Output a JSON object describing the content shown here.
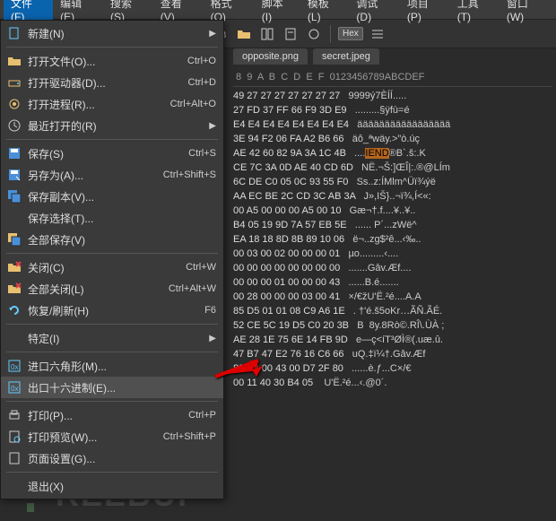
{
  "menubar": [
    "文件(F)",
    "编辑(E)",
    "搜索(S)",
    "查看(V)",
    "格式(O)",
    "脚本(I)",
    "模板(L)",
    "调试(D)",
    "项目(P)",
    "工具(T)",
    "窗口(W)"
  ],
  "toolbar": {
    "hex_label": "Hex"
  },
  "tabs": [
    "opposite.png",
    "secret.jpeg"
  ],
  "menu": {
    "items": [
      {
        "icon": "new",
        "label": "新建(N)",
        "shortcut": "",
        "sub": true
      },
      {
        "sep": true
      },
      {
        "icon": "open",
        "label": "打开文件(O)...",
        "shortcut": "Ctrl+O"
      },
      {
        "icon": "drive",
        "label": "打开驱动器(D)...",
        "shortcut": "Ctrl+D"
      },
      {
        "icon": "proc",
        "label": "打开进程(R)...",
        "shortcut": "Ctrl+Alt+O"
      },
      {
        "icon": "recent",
        "label": "最近打开的(R)",
        "shortcut": "",
        "sub": true
      },
      {
        "sep": true
      },
      {
        "icon": "save",
        "label": "保存(S)",
        "shortcut": "Ctrl+S"
      },
      {
        "icon": "saveas",
        "label": "另存为(A)...",
        "shortcut": "Ctrl+Shift+S"
      },
      {
        "icon": "savecopy",
        "label": "保存副本(V)...",
        "shortcut": ""
      },
      {
        "icon": "",
        "label": "保存选择(T)...",
        "shortcut": ""
      },
      {
        "icon": "saveall",
        "label": "全部保存(V)",
        "shortcut": ""
      },
      {
        "sep": true
      },
      {
        "icon": "close",
        "label": "关闭(C)",
        "shortcut": "Ctrl+W"
      },
      {
        "icon": "closeall",
        "label": "全部关闭(L)",
        "shortcut": "Ctrl+Alt+W"
      },
      {
        "icon": "refresh",
        "label": "恢复/刷新(H)",
        "shortcut": "F6"
      },
      {
        "sep": true
      },
      {
        "icon": "",
        "label": "特定(I)",
        "shortcut": "",
        "sub": true
      },
      {
        "sep": true
      },
      {
        "icon": "imphex",
        "label": "进口六角形(M)...",
        "shortcut": ""
      },
      {
        "icon": "exphex",
        "label": "出口十六进制(E)...",
        "shortcut": "",
        "hl": true
      },
      {
        "sep": true
      },
      {
        "icon": "print",
        "label": "打印(P)...",
        "shortcut": "Ctrl+P"
      },
      {
        "icon": "preview",
        "label": "打印预览(W)...",
        "shortcut": "Ctrl+Shift+P"
      },
      {
        "icon": "page",
        "label": "页面设置(G)...",
        "shortcut": ""
      },
      {
        "sep": true
      },
      {
        "icon": "",
        "label": "退出(X)",
        "shortcut": ""
      }
    ]
  },
  "hex": {
    "header": " 8  9  A  B  C  D  E  F  0123456789ABCDEF",
    "rows": [
      {
        "h": "49 27 27 27 27 27 27 27",
        "a": " 9999ý7ÈÍÍ.....",
        "hl": ""
      },
      {
        "h": "27 FD 37 FF 66 F9 3D E9",
        "a": " .........§ÿfù=é",
        "hl": ""
      },
      {
        "h": "E4 E4 E4 E4 E4 E4 E4 E4",
        "a": " äääääääääääääääää",
        "hl": ""
      },
      {
        "h": "3E 94 F2 06 FA A2 B6 66",
        "a": " äô_ªwäy.>\"ò.úç<f",
        "hl": ""
      },
      {
        "h": "AE 42 60 82 9A 3A 1C 4B",
        "a": " ....IEND®B`.š:.K",
        "hl": "IEND"
      },
      {
        "h": "CE 7C 3A 0D AE 40 CD 6D",
        "a": " NË.¬Š:]ŒÎ|:.®@LÍm",
        "hl": ""
      },
      {
        "h": "6C DE C0 05 0C 93 55 F0",
        "a": " Ss..z:ÍMlm^Üï¾ýë",
        "hl": ""
      },
      {
        "h": "AA EC BE 2C CD 3C AB 3A",
        "a": " J»,IŠ}..¬ï¾,Í<«:",
        "hl": ""
      },
      {
        "h": "00 A5 00 00 00 A5 00 10",
        "a": " Gæ¬†.f....¥..¥..",
        "hl": ""
      },
      {
        "h": "B4 05 19 9D 7A 57 EB 5E",
        "a": " ...... P´...zWë^",
        "hl": ""
      },
      {
        "h": "EA 18 18 8D 8B 89 10 06",
        "a": " ë¬..zg$²ê...‹‰..",
        "hl": ""
      },
      {
        "h": "00 03 00 02 00 00 00 01",
        "a": " µo.........‹....",
        "hl": ""
      },
      {
        "h": "00 00 00 00 00 00 00 00",
        "a": " .......Gâv.Æf....",
        "hl": ""
      },
      {
        "h": "00 00 00 01 00 00 00 43",
        "a": " ......B.é.......",
        "hl": ""
      },
      {
        "h": "00 28 00 00 00 03 00 41",
        "a": " ×/€žU'Ë.²é....A.A",
        "hl": ""
      },
      {
        "h": "85 D5 01 01 08 C9 A6 1E",
        "a": " . †'é.š5oKr…ÃÑ.ÃÉ.",
        "hl": ""
      },
      {
        "h": "52 CE 5C 19 D5 C0 20 3B",
        "a": " B  8y.8Rò©.RÎ\\.ÙÀ ;",
        "hl": ""
      },
      {
        "h": "AE 28 1E 75 6E 14 FB 9D",
        "a": " e—ç<íT³ØÌ®(.uæ.û.",
        "hl": ""
      },
      {
        "h": "47 B7 47 E2 76 16 C6 66",
        "a": " uQ.‡ï¼†.Gâv.Æf",
        "hl": ""
      },
      {
        "h": "83 B8 00 43 00 D7 2F 80",
        "a": " ......è.ƒ...C×/€",
        "hl": ""
      },
      {
        "h": "00 11 40 30 B4 05 ",
        "a": " U'Ë.²é...‹.@0´.",
        "hl": ""
      }
    ]
  },
  "watermark": "REEBUF"
}
